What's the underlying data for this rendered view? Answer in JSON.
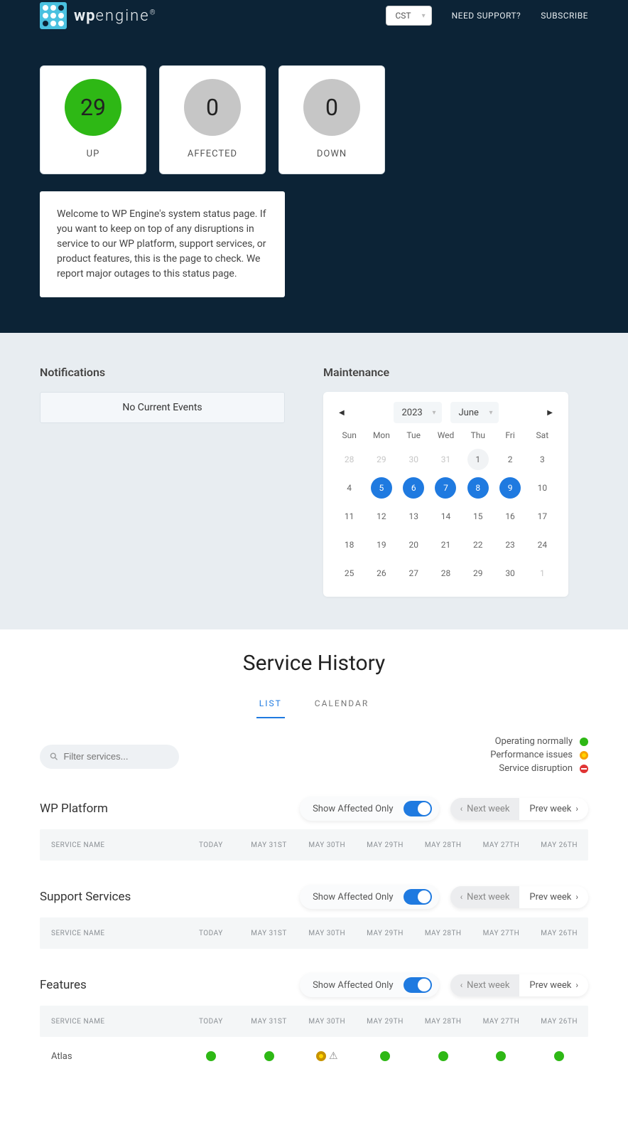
{
  "header": {
    "brand_bold": "wp",
    "brand_light": "engine",
    "tz": "CST",
    "need_support": "NEED SUPPORT?",
    "subscribe": "SUBSCRIBE"
  },
  "status_cards": [
    {
      "count": "29",
      "label": "UP",
      "color": "green"
    },
    {
      "count": "0",
      "label": "AFFECTED",
      "color": "gray"
    },
    {
      "count": "0",
      "label": "DOWN",
      "color": "gray"
    }
  ],
  "welcome_text": "Welcome to WP Engine's system status page. If you want to keep on top of any disruptions in service to our WP platform, support services, or product features, this is the page to check. We report major outages to this status page.",
  "notifications": {
    "title": "Notifications",
    "empty": "No Current Events"
  },
  "maintenance": {
    "title": "Maintenance",
    "year": "2023",
    "month": "June",
    "dow": [
      "Sun",
      "Mon",
      "Tue",
      "Wed",
      "Thu",
      "Fri",
      "Sat"
    ],
    "cells": [
      {
        "n": "28",
        "cls": "out"
      },
      {
        "n": "29",
        "cls": "out"
      },
      {
        "n": "30",
        "cls": "out"
      },
      {
        "n": "31",
        "cls": "out"
      },
      {
        "n": "1",
        "cls": "today"
      },
      {
        "n": "2",
        "cls": ""
      },
      {
        "n": "3",
        "cls": ""
      },
      {
        "n": "4",
        "cls": ""
      },
      {
        "n": "5",
        "cls": "event"
      },
      {
        "n": "6",
        "cls": "event"
      },
      {
        "n": "7",
        "cls": "event"
      },
      {
        "n": "8",
        "cls": "event"
      },
      {
        "n": "9",
        "cls": "event"
      },
      {
        "n": "10",
        "cls": ""
      },
      {
        "n": "11",
        "cls": ""
      },
      {
        "n": "12",
        "cls": ""
      },
      {
        "n": "13",
        "cls": ""
      },
      {
        "n": "14",
        "cls": ""
      },
      {
        "n": "15",
        "cls": ""
      },
      {
        "n": "16",
        "cls": ""
      },
      {
        "n": "17",
        "cls": ""
      },
      {
        "n": "18",
        "cls": ""
      },
      {
        "n": "19",
        "cls": ""
      },
      {
        "n": "20",
        "cls": ""
      },
      {
        "n": "21",
        "cls": ""
      },
      {
        "n": "22",
        "cls": ""
      },
      {
        "n": "23",
        "cls": ""
      },
      {
        "n": "24",
        "cls": ""
      },
      {
        "n": "25",
        "cls": ""
      },
      {
        "n": "26",
        "cls": ""
      },
      {
        "n": "27",
        "cls": ""
      },
      {
        "n": "28",
        "cls": ""
      },
      {
        "n": "29",
        "cls": ""
      },
      {
        "n": "30",
        "cls": ""
      },
      {
        "n": "1",
        "cls": "out"
      }
    ]
  },
  "history": {
    "title": "Service History",
    "tab_list": "LIST",
    "tab_calendar": "CALENDAR",
    "search_placeholder": "Filter services...",
    "legend": {
      "ok": "Operating normally",
      "perf": "Performance issues",
      "disruption": "Service disruption"
    },
    "labels": {
      "show_affected": "Show Affected Only",
      "next_week": "Next week",
      "prev_week": "Prev week",
      "service_name_col": "SERVICE NAME"
    },
    "date_cols": [
      "TODAY",
      "MAY 31ST",
      "MAY 30TH",
      "MAY 29TH",
      "MAY 28TH",
      "MAY 27TH",
      "MAY 26TH"
    ],
    "sections": [
      {
        "name": "WP Platform",
        "rows": []
      },
      {
        "name": "Support Services",
        "rows": []
      },
      {
        "name": "Features",
        "rows": [
          {
            "name": "Atlas",
            "statuses": [
              "green",
              "green",
              "yellow-warn",
              "green",
              "green",
              "green",
              "green"
            ]
          }
        ]
      }
    ]
  }
}
